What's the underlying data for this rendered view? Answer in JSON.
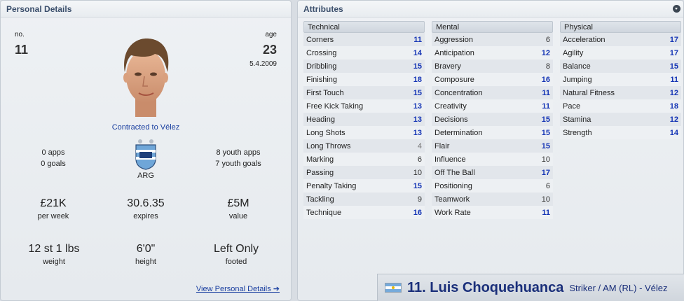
{
  "personal": {
    "header": "Personal Details",
    "no_label": "no.",
    "no_value": "11",
    "age_label": "age",
    "age_value": "23",
    "dob": "5.4.2009",
    "contract": "Contracted to Vélez",
    "apps": "0 apps",
    "goals": "0 goals",
    "youth_apps": "8 youth apps",
    "youth_goals": "7 youth goals",
    "nation": "ARG",
    "wage": "£21K",
    "wage_label": "per week",
    "expires": "30.6.35",
    "expires_label": "expires",
    "value": "£5M",
    "value_label": "value",
    "weight": "12 st 1 lbs",
    "weight_label": "weight",
    "height": "6'0\"",
    "height_label": "height",
    "footed": "Left Only",
    "footed_label": "footed",
    "view_link": "View Personal Details ➔"
  },
  "attributes": {
    "header": "Attributes",
    "technical": {
      "title": "Technical",
      "rows": [
        {
          "name": "Corners",
          "value": "11"
        },
        {
          "name": "Crossing",
          "value": "14"
        },
        {
          "name": "Dribbling",
          "value": "15"
        },
        {
          "name": "Finishing",
          "value": "18"
        },
        {
          "name": "First Touch",
          "value": "15"
        },
        {
          "name": "Free Kick Taking",
          "value": "13"
        },
        {
          "name": "Heading",
          "value": "13"
        },
        {
          "name": "Long Shots",
          "value": "13"
        },
        {
          "name": "Long Throws",
          "value": "4"
        },
        {
          "name": "Marking",
          "value": "6"
        },
        {
          "name": "Passing",
          "value": "10"
        },
        {
          "name": "Penalty Taking",
          "value": "15"
        },
        {
          "name": "Tackling",
          "value": "9"
        },
        {
          "name": "Technique",
          "value": "16"
        }
      ]
    },
    "mental": {
      "title": "Mental",
      "rows": [
        {
          "name": "Aggression",
          "value": "6"
        },
        {
          "name": "Anticipation",
          "value": "12"
        },
        {
          "name": "Bravery",
          "value": "8"
        },
        {
          "name": "Composure",
          "value": "16"
        },
        {
          "name": "Concentration",
          "value": "11"
        },
        {
          "name": "Creativity",
          "value": "11"
        },
        {
          "name": "Decisions",
          "value": "15"
        },
        {
          "name": "Determination",
          "value": "15"
        },
        {
          "name": "Flair",
          "value": "15"
        },
        {
          "name": "Influence",
          "value": "10"
        },
        {
          "name": "Off The Ball",
          "value": "17"
        },
        {
          "name": "Positioning",
          "value": "6"
        },
        {
          "name": "Teamwork",
          "value": "10"
        },
        {
          "name": "Work Rate",
          "value": "11"
        }
      ]
    },
    "physical": {
      "title": "Physical",
      "rows": [
        {
          "name": "Acceleration",
          "value": "17"
        },
        {
          "name": "Agility",
          "value": "17"
        },
        {
          "name": "Balance",
          "value": "15"
        },
        {
          "name": "Jumping",
          "value": "11"
        },
        {
          "name": "Natural Fitness",
          "value": "12"
        },
        {
          "name": "Pace",
          "value": "18"
        },
        {
          "name": "Stamina",
          "value": "12"
        },
        {
          "name": "Strength",
          "value": "14"
        }
      ]
    }
  },
  "banner": {
    "name": "11. Luis Choquehuanca",
    "position": "Striker / AM (RL) - Vélez"
  },
  "colors": {
    "highlight_value": "#1535b5",
    "name_blue": "#1a2f7a",
    "link_blue": "#1a3fa0"
  },
  "icons": [
    "collapse-icon",
    "argentina-flag-icon",
    "afa-badge-icon",
    "arrow-right-icon"
  ]
}
